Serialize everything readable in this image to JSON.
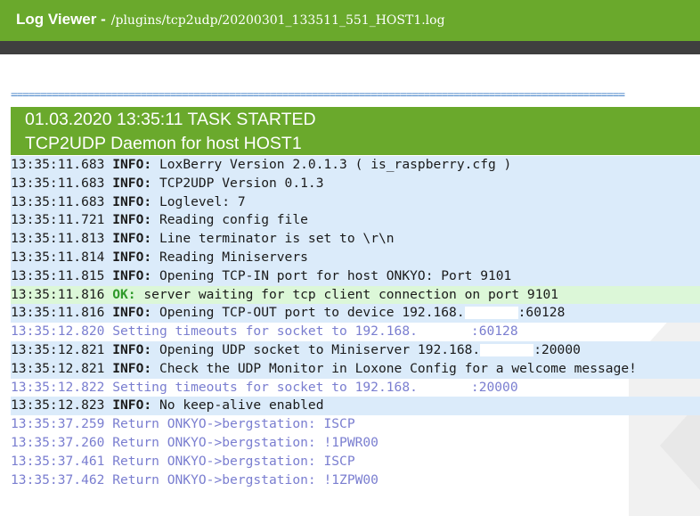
{
  "header": {
    "app_title": "Log Viewer -",
    "log_path": "/plugins/tcp2udp/20200301_133511_551_HOST1.log"
  },
  "separator": "========================================================================================================",
  "task": {
    "line1": "01.03.2020 13:35:11 TASK STARTED",
    "line2": "TCP2UDP Daemon for host HOST1"
  },
  "log": [
    {
      "type": "info",
      "time": "13:35:11.683",
      "level": "INFO:",
      "msg": "LoxBerry Version 2.0.1.3 ( is_raspberry.cfg )",
      "suffix": ""
    },
    {
      "type": "info",
      "time": "13:35:11.683",
      "level": "INFO:",
      "msg": "TCP2UDP Version 0.1.3",
      "suffix": ""
    },
    {
      "type": "info",
      "time": "13:35:11.683",
      "level": "INFO:",
      "msg": "Loglevel: 7",
      "suffix": ""
    },
    {
      "type": "info",
      "time": "13:35:11.721",
      "level": "INFO:",
      "msg": "Reading config file",
      "suffix": ""
    },
    {
      "type": "info",
      "time": "13:35:11.813",
      "level": "INFO:",
      "msg": "Line terminator is set to \\r\\n",
      "suffix": ""
    },
    {
      "type": "info",
      "time": "13:35:11.814",
      "level": "INFO:",
      "msg": "Reading Miniservers",
      "suffix": ""
    },
    {
      "type": "info",
      "time": "13:35:11.815",
      "level": "INFO:",
      "msg": "Opening TCP-IN port for host ONKYO: Port 9101",
      "suffix": ""
    },
    {
      "type": "ok",
      "time": "13:35:11.816",
      "level": "OK:",
      "msg": "server waiting for tcp client connection on port 9101",
      "suffix": ""
    },
    {
      "type": "info",
      "time": "13:35:11.816",
      "level": "INFO:",
      "msg": "Opening TCP-OUT port to device 192.168.",
      "suffix": ":60128"
    },
    {
      "type": "plain",
      "time": "13:35:12.820",
      "level": "",
      "msg": "Setting timeouts for socket to 192.168.",
      "suffix": ":60128"
    },
    {
      "type": "info",
      "time": "13:35:12.821",
      "level": "INFO:",
      "msg": "Opening UDP socket to Miniserver 192.168.",
      "suffix": ":20000"
    },
    {
      "type": "info",
      "time": "13:35:12.821",
      "level": "INFO:",
      "msg": "Check the UDP Monitor in Loxone Config for a welcome message!",
      "suffix": ""
    },
    {
      "type": "plain",
      "time": "13:35:12.822",
      "level": "",
      "msg": "Setting timeouts for socket to 192.168.",
      "suffix": ":20000"
    },
    {
      "type": "info",
      "time": "13:35:12.823",
      "level": "INFO:",
      "msg": "No keep-alive enabled",
      "suffix": ""
    },
    {
      "type": "plain",
      "time": "13:35:37.259",
      "level": "",
      "msg": "Return ONKYO->bergstation: ISCP",
      "suffix": ""
    },
    {
      "type": "plain",
      "time": "13:35:37.260",
      "level": "",
      "msg": "Return ONKYO->bergstation: !1PWR00",
      "suffix": ""
    },
    {
      "type": "plain",
      "time": "13:35:37.461",
      "level": "",
      "msg": "Return ONKYO->bergstation: ISCP",
      "suffix": ""
    },
    {
      "type": "plain",
      "time": "13:35:37.462",
      "level": "",
      "msg": "Return ONKYO->bergstation: !1ZPW00",
      "suffix": ""
    }
  ]
}
